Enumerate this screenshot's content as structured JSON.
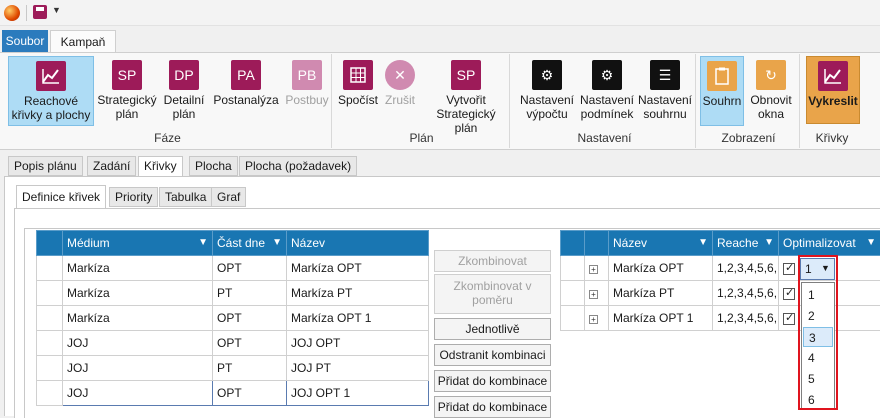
{
  "ribbon_tabs": {
    "file": "Soubor",
    "campaign": "Kampaň"
  },
  "groups": {
    "faze": {
      "label": "Fáze",
      "buttons": [
        "Reachové křivky a plochy",
        "Strategický plán",
        "Detailní plán",
        "Postanalýza",
        "Postbuy"
      ]
    },
    "plan": {
      "label": "Plán",
      "buttons": [
        "Spočíst",
        "Zrušit",
        "Vytvořit Strategický plán"
      ]
    },
    "nastaveni": {
      "label": "Nastavení",
      "buttons": [
        "Nastavení výpočtu",
        "Nastavení podmínek",
        "Nastavení souhrnu"
      ]
    },
    "zobrazeni": {
      "label": "Zobrazení",
      "buttons": [
        "Souhrn",
        "Obnovit okna"
      ]
    },
    "krivky": {
      "label": "Křivky",
      "buttons": [
        "Vykreslit"
      ]
    }
  },
  "icon_text": {
    "sp": "SP",
    "dp": "DP",
    "pa": "PA",
    "pb": "PB",
    "sp2": "SP"
  },
  "colors": {
    "magenta": "#9d1b59",
    "orange_btn": "#e9a44a",
    "blue_header": "#1976b2",
    "black": "#111111"
  },
  "content_tabs": [
    "Popis plánu",
    "Zadání",
    "Křivky",
    "Plocha",
    "Plocha (požadavek)"
  ],
  "sub_tabs": [
    "Definice křivek",
    "Priority",
    "Tabulka",
    "Graf"
  ],
  "left_grid": {
    "headers": [
      "Médium",
      "Část dne",
      "Název"
    ],
    "rows": [
      [
        "Markíza",
        "OPT",
        "Markíza OPT"
      ],
      [
        "Markíza",
        "PT",
        "Markíza PT"
      ],
      [
        "Markíza",
        "OPT",
        "Markíza OPT 1"
      ],
      [
        "JOJ",
        "OPT",
        "JOJ OPT"
      ],
      [
        "JOJ",
        "PT",
        "JOJ PT"
      ],
      [
        "JOJ",
        "OPT",
        "JOJ OPT 1"
      ]
    ]
  },
  "mid_buttons": [
    "Zkombinovat",
    "Zkombinovat v poměru",
    "Jednotlivě",
    "Odstranit kombinaci",
    "Přidat do kombinace",
    "Přidat do kombinace"
  ],
  "right_grid": {
    "headers": [
      "Název",
      "Reache",
      "Optimalizovat"
    ],
    "rows": [
      [
        "Markíza OPT",
        "1,2,3,4,5,6,",
        "1"
      ],
      [
        "Markíza PT",
        "1,2,3,4,5,6,",
        ""
      ],
      [
        "Markíza OPT 1",
        "1,2,3,4,5,6,",
        ""
      ]
    ]
  },
  "dropdown": {
    "selected": "1",
    "options": [
      "1",
      "2",
      "3",
      "4",
      "5",
      "6"
    ],
    "highlighted": "3"
  }
}
